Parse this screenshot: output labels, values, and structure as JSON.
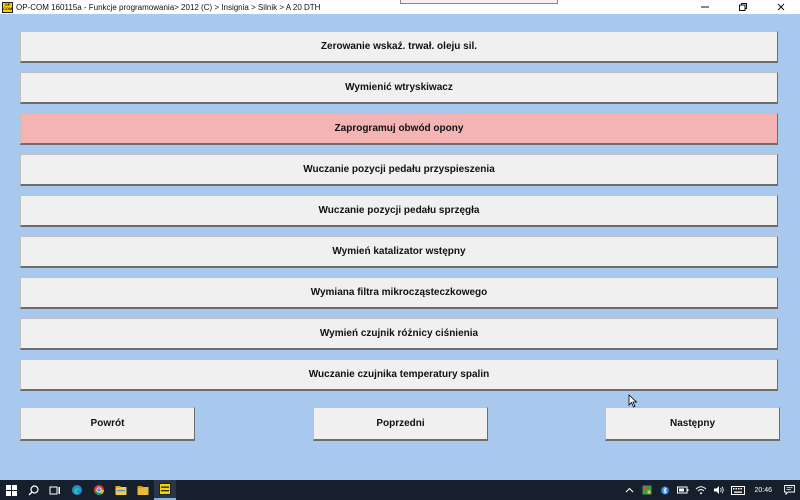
{
  "window": {
    "logo_text": "OP COM",
    "title": "OP-COM 160115a - Funkcje programowania> 2012 (C) > Insignia > Silnik > A 20 DTH",
    "controls": [
      "minimize-icon",
      "restore-icon",
      "close-icon"
    ]
  },
  "functions": [
    {
      "label": "Zerowanie wskaź. trwał. oleju sil.",
      "selected": false
    },
    {
      "label": "Wymienić wtryskiwacz",
      "selected": false
    },
    {
      "label": "Zaprogramuj obwód opony",
      "selected": true
    },
    {
      "label": "Wuczanie pozycji pedału przyspieszenia",
      "selected": false
    },
    {
      "label": "Wuczanie pozycji pedału sprzęgła",
      "selected": false
    },
    {
      "label": "Wymień katalizator wstępny",
      "selected": false
    },
    {
      "label": "Wymiana filtra mikrocząsteczkowego",
      "selected": false
    },
    {
      "label": "Wymień czujnik różnicy ciśnienia",
      "selected": false
    },
    {
      "label": "Wuczanie czujnika temperatury spalin",
      "selected": false
    }
  ],
  "navigation": {
    "back": "Powrót",
    "previous": "Poprzedni",
    "next": "Następny"
  },
  "colors": {
    "background": "#a8c8ee",
    "button": "#f0f0f0",
    "selected": "#f4b4b4",
    "taskbar": "#16202c"
  },
  "taskbar": {
    "apps": [
      "windows-start-icon",
      "search-icon",
      "task-view-icon",
      "edge-icon",
      "chrome-icon",
      "file-explorer-icon",
      "folder-icon",
      "opcom-icon"
    ],
    "tray": [
      "chevron-up-icon",
      "app-tray-icon",
      "bluetooth-icon",
      "battery-icon",
      "wifi-icon",
      "volume-icon",
      "keyboard-icon"
    ],
    "clock": "20:46"
  }
}
